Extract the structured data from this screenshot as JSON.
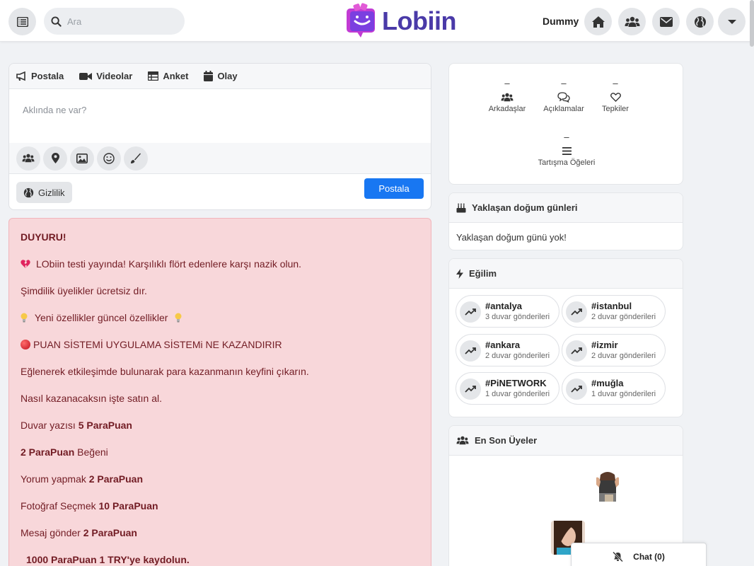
{
  "header": {
    "search_placeholder": "Ara",
    "logo_text": "Lobiin",
    "username": "Dummy"
  },
  "composer": {
    "tabs": [
      "Postala",
      "Videolar",
      "Anket",
      "Olay"
    ],
    "placeholder": "Aklında ne var?",
    "privacy_label": "Gizlilik",
    "post_button": "Postala"
  },
  "announcement": {
    "lines": [
      "DUYURU!",
      "LObiin testi yayında! Karşılıklı flört edenlere karşı nazik olun.",
      "Şimdilik üyelikler ücretsiz dır.",
      "Yeni özellikler güncel özellikler",
      "PUAN SİSTEMİ UYGULAMA SİSTEMi NE KAZANDIRIR",
      "Eğlenerek etkileşimde bulunarak para kazanmanın keyfini çıkarın.",
      "Nasıl kazanacaksın işte satın al."
    ],
    "earn": {
      "wall_post": "Duvar yazısı",
      "wall_post_points": "5 ParaPuan",
      "like_points": "2 ParaPuan",
      "like": "Beğeni",
      "comment": "Yorum yapmak",
      "comment_points": "2 ParaPuan",
      "photo": "Fotoğraf Seçmek",
      "photo_points": "10 ParaPuan",
      "message": "Mesaj gönder",
      "message_points": "2 ParaPuan",
      "signup": "1000 ParaPuan 1 TRY'ye kaydolun."
    }
  },
  "stats": [
    {
      "value": "–",
      "label": "Arkadaşlar"
    },
    {
      "value": "–",
      "label": "Açıklamalar"
    },
    {
      "value": "–",
      "label": "Tepkiler"
    },
    {
      "value": "–",
      "label": "Tartışma Öğeleri"
    }
  ],
  "birthdays": {
    "title": "Yaklaşan doğum günleri",
    "empty": "Yaklaşan doğum günü yok!"
  },
  "trending": {
    "title": "Eğilim",
    "tags": [
      {
        "name": "#antalya",
        "count": "3 duvar gönderileri"
      },
      {
        "name": "#istanbul",
        "count": "2 duvar gönderileri"
      },
      {
        "name": "#ankara",
        "count": "2 duvar gönderileri"
      },
      {
        "name": "#izmir",
        "count": "2 duvar gönderileri"
      },
      {
        "name": "#PiNETWORK",
        "count": "1 duvar gönderileri"
      },
      {
        "name": "#muğla",
        "count": "1 duvar gönderileri"
      }
    ]
  },
  "members": {
    "title": "En Son Üyeler"
  },
  "chat": {
    "label": "Chat (0)"
  },
  "icons": [
    "list-icon",
    "search-icon",
    "home-icon",
    "users-icon",
    "envelope-icon",
    "globe-icon",
    "caret-down-icon",
    "megaphone-icon",
    "video-icon",
    "table-icon",
    "calendar-icon",
    "map-pin-icon",
    "image-icon",
    "smile-icon",
    "brush-icon",
    "comments-icon",
    "heart-icon",
    "bars-icon",
    "cake-icon",
    "bolt-icon",
    "trend-up-icon",
    "bell-slash-icon"
  ],
  "colors": {
    "primary": "#1877f2",
    "logo": "#4a3aa8",
    "logo_accent": "#c23bd4",
    "announce_bg": "#f8d7da",
    "announce_text": "#721c24"
  }
}
